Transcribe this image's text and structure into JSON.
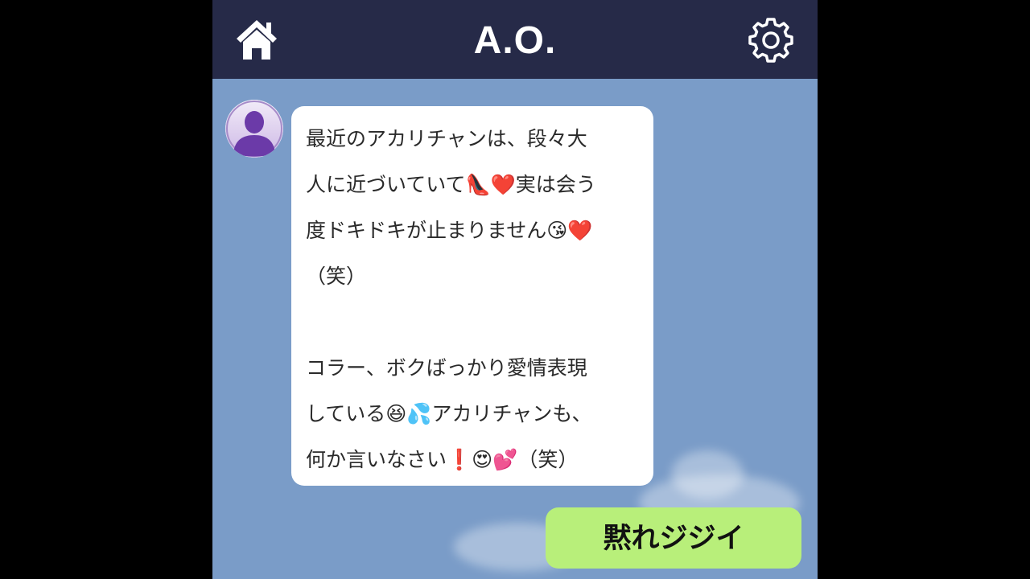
{
  "header": {
    "title": "A.O.",
    "background": "#262a48",
    "left_icon": "home-icon",
    "right_icon": "gear-icon"
  },
  "chat": {
    "background": "#7a9cc8",
    "incoming": {
      "avatar_icon": "person-silhouette-icon",
      "bubble_color": "#ffffff",
      "lines": [
        "最近のアカリチャンは、段々大",
        "人に近づいていて👠❤️実は会う",
        "度ドキドキが止まりません😘❤️",
        "（笑）",
        "",
        "コラー、ボクばっかり愛情表現",
        "している😆💦アカリチャンも、",
        "何か言いなさい❗😍💕（笑）"
      ]
    },
    "outgoing": {
      "text": "黙れジジイ",
      "bubble_color": "#b8ef7a"
    }
  }
}
